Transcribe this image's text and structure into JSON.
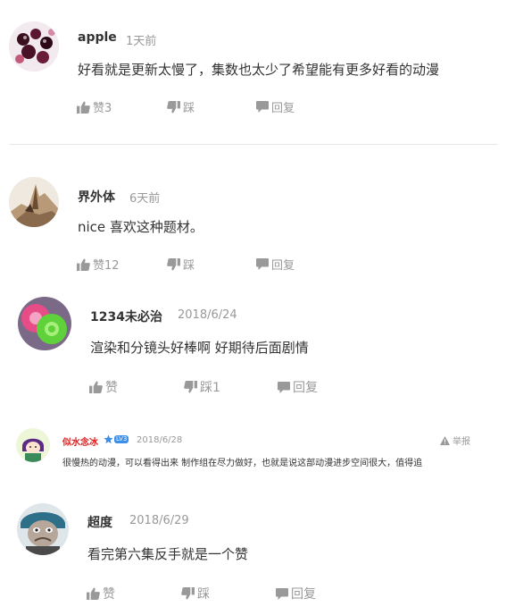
{
  "comments": [
    {
      "username": "apple",
      "time": "1天前",
      "text": "好看就是更新太慢了，集数也太少了希望能有更多好看的动漫",
      "like": "赞3",
      "dislike": "踩",
      "reply": "回复"
    },
    {
      "username": "界外体",
      "time": "6天前",
      "text": "nice 喜欢这种题材。",
      "like": "赞12",
      "dislike": "踩",
      "reply": "回复"
    },
    {
      "username": "1234未必治",
      "time": "2018/6/24",
      "text": "渲染和分镜头好棒啊 好期待后面剧情",
      "like": "赞",
      "dislike": "踩1",
      "reply": "回复"
    },
    {
      "username": "似水念冰",
      "level": "LV3",
      "time": "2018/6/28",
      "report": "举报",
      "text": "很慢热的动漫，可以看得出来 制作组在尽力做好，也就是说这部动漫进步空间很大，值得追"
    },
    {
      "username": "超度",
      "time": "2018/6/29",
      "text": "看完第六集反手就是一个赞",
      "like": "赞",
      "dislike": "踩",
      "reply": "回复"
    }
  ],
  "colors": {
    "accent_red": "#e02020",
    "muted": "#999999",
    "text": "#333333",
    "badge_blue": "#3d8ee8"
  },
  "icons": {
    "like": "thumbs-up-icon",
    "dislike": "thumbs-down-icon",
    "reply": "speech-bubble-icon",
    "report": "warning-triangle-icon",
    "level": "star-badge-icon"
  }
}
